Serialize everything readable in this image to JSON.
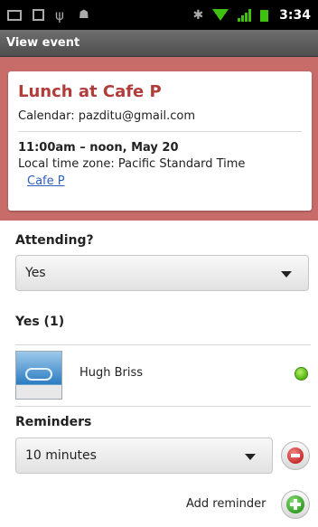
{
  "status_bar": {
    "time": "3:34",
    "icons": [
      "mail-icon",
      "sd-card-icon",
      "usb-icon",
      "android-debug-icon",
      "bluetooth-icon",
      "wifi-icon",
      "signal-icon",
      "battery-icon"
    ]
  },
  "title_bar": {
    "title": "View event"
  },
  "event": {
    "title": "Lunch at Cafe P",
    "calendar_label": "Calendar:",
    "calendar_value": "pazditu@gmail.com",
    "when": "11:00am – noon, May 20",
    "timezone_label": "Local time zone:",
    "timezone_value": "Pacific Standard Time",
    "location": "Cafe P",
    "header_color": "#c86c6a",
    "title_color": "#b13c3a"
  },
  "attending": {
    "label": "Attending?",
    "selected": "Yes"
  },
  "attendees": {
    "group_label": "Yes (1)",
    "items": [
      {
        "name": "Hugh Briss",
        "status": "available",
        "status_color": "#52b40e"
      }
    ]
  },
  "reminders": {
    "label": "Reminders",
    "items": [
      {
        "value": "10 minutes"
      }
    ],
    "add_label": "Add reminder"
  }
}
